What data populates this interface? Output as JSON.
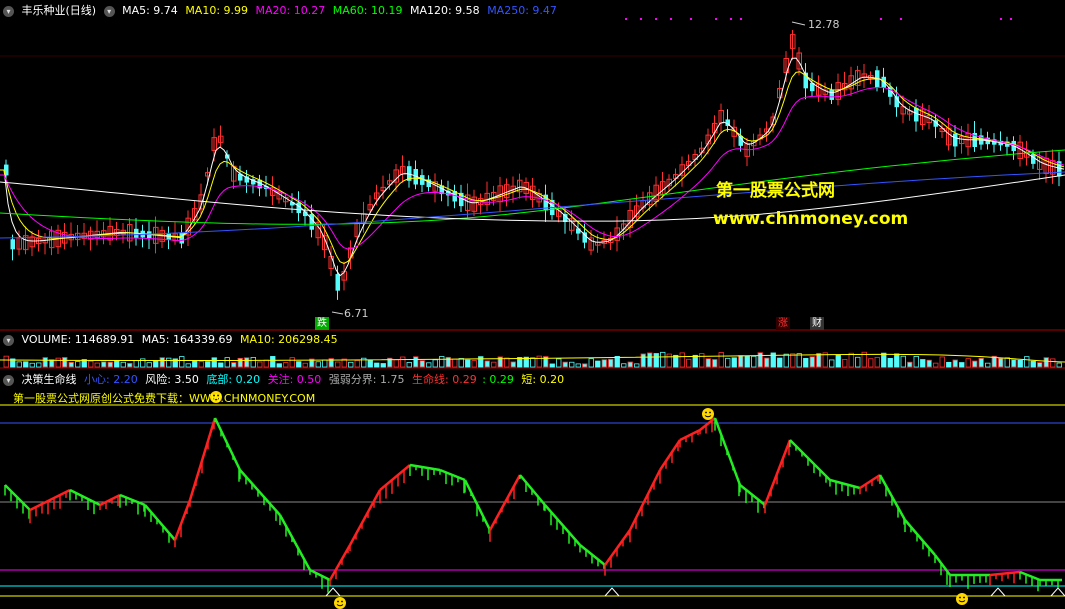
{
  "header": {
    "stock_name": "丰乐种业(日线)",
    "ma_labels": [
      {
        "text": "MA5: 9.74",
        "color": "#ffffff"
      },
      {
        "text": "MA10: 9.99",
        "color": "#ffff00"
      },
      {
        "text": "MA20: 10.27",
        "color": "#ff00ff"
      },
      {
        "text": "MA60: 10.19",
        "color": "#00ff00"
      },
      {
        "text": "MA120: 9.58",
        "color": "#ffffff"
      },
      {
        "text": "MA250: 9.47",
        "color": "#3355ff"
      }
    ]
  },
  "price_chart": {
    "high_label": "12.78",
    "low_label": "6.71",
    "tags": [
      {
        "text": "跌",
        "color": "#ffffff",
        "bg": "#00aa00"
      },
      {
        "text": "涨",
        "color": "#ff3030",
        "bg": "#330000"
      },
      {
        "text": "财",
        "color": "#ffffff",
        "bg": "#333333"
      }
    ],
    "watermark_cn": "第一股票公式网",
    "watermark_url": "www.chnmoney.com"
  },
  "volume_bar": {
    "label": "VOLUME: 114689.91",
    "ma5": "MA5: 164339.69",
    "ma10": "MA10: 206298.45"
  },
  "indicator_bar": {
    "name": "决策生命线",
    "items": [
      {
        "text": "小心: 2.20",
        "color": "#3355ff"
      },
      {
        "text": "风险: 3.50",
        "color": "#ffffff"
      },
      {
        "text": "底部: 0.20",
        "color": "#00ffff"
      },
      {
        "text": "关注: 0.50",
        "color": "#ff00ff"
      },
      {
        "text": "强弱分界: 1.75",
        "color": "#aaaaaa"
      },
      {
        "text": "生命线: 0.29",
        "color": "#ff3030"
      },
      {
        "text": ": 0.29",
        "color": "#00ff00"
      },
      {
        "text": "短: 0.20",
        "color": "#ffff00"
      }
    ],
    "promo": "第一股票公式网原创公式免费下载：WWW.CHNMONEY.COM"
  },
  "colors": {
    "up": "#ff3030",
    "down": "#54fcfc",
    "separator": "#aa0000"
  }
}
